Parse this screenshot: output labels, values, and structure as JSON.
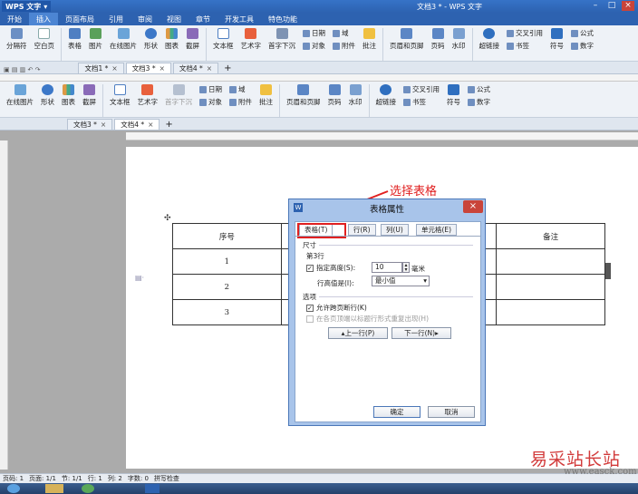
{
  "app": {
    "logo": "WPS 文字",
    "window_title": "文档3 * - WPS 文字"
  },
  "menu": [
    "开始",
    "插入",
    "页面布局",
    "引用",
    "审阅",
    "视图",
    "章节",
    "开发工具",
    "特色功能"
  ],
  "ribbon1": {
    "tools": [
      "分隔符",
      "空白页",
      "表格",
      "图片",
      "在线图片",
      "形状",
      "图表",
      "截屏",
      "文本框",
      "艺术字",
      "首字下沉",
      "批注",
      "页眉和页脚",
      "页码",
      "水印",
      "超链接",
      "符号"
    ],
    "mini_a": [
      "日期",
      "对象"
    ],
    "mini_b": [
      "域",
      "附件"
    ],
    "mini_c": [
      "交叉引用",
      "书签"
    ],
    "mini_d": [
      "公式",
      "数字"
    ]
  },
  "tabs1": [
    {
      "label": "文档1 *"
    },
    {
      "label": "文档3 *",
      "active": true
    },
    {
      "label": "文档4 *"
    }
  ],
  "ribbon2": {
    "tools": [
      "在线图片",
      "形状",
      "图表",
      "截屏",
      "文本框",
      "艺术字",
      "首字下沉",
      "批注",
      "页眉和页脚",
      "页码",
      "水印",
      "超链接",
      "符号"
    ],
    "mini_a": [
      "日期",
      "对象"
    ],
    "mini_b": [
      "域",
      "附件"
    ],
    "mini_c": [
      "交叉引用",
      "书签"
    ],
    "mini_d": [
      "公式",
      "数字"
    ]
  },
  "tabs2": [
    {
      "label": "文档3 *"
    },
    {
      "label": "文档4 *",
      "active": true
    }
  ],
  "table": {
    "headers": [
      "序号",
      "备注"
    ],
    "rows": [
      "1",
      "2",
      "3"
    ]
  },
  "dialog": {
    "title": "表格属性",
    "close": "×",
    "tabs": [
      "表格(T)",
      "行(R)",
      "列(U)",
      "单元格(E)"
    ],
    "section_size": "尺寸",
    "row_label": "第3行",
    "specify_height": "指定高度(S):",
    "height_value": "10",
    "unit": "毫米",
    "row_height_is": "行高值是(I):",
    "row_height_mode": "最小值",
    "section_options": "选项",
    "allow_break": "允许跨页断行(K)",
    "repeat_header": "在各页顶端以标题行形式重复出现(H)",
    "prev_row": "上一行(P)",
    "next_row": "下一行(N)",
    "ok": "确定",
    "cancel": "取消"
  },
  "annotation": "选择表格",
  "status": [
    "页码: 1",
    "页面: 1/1",
    "节: 1/1",
    "行: 1",
    "列: 2",
    "字数: 0",
    "拼写检查"
  ],
  "watermark": {
    "main": "易采站长站",
    "url": "www.easck.com"
  },
  "colors": {
    "accent": "#2d62b0",
    "highlight": "#e02020",
    "dialog_frame": "#a8c4ea"
  }
}
